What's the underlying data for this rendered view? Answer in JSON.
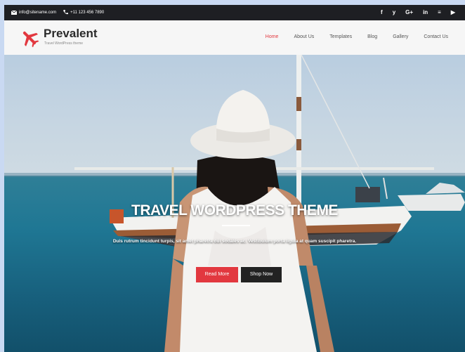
{
  "topbar": {
    "email": "info@sitename.com",
    "phone": "+11 123 456 7890",
    "social_icons": [
      "facebook-icon",
      "twitter-icon",
      "google-plus-icon",
      "linkedin-icon",
      "rss-icon",
      "youtube-icon"
    ],
    "social_glyphs": [
      "f",
      "y",
      "G+",
      "in",
      "≡",
      "▶"
    ]
  },
  "header": {
    "brand": "Prevalent",
    "tagline": "Travel WordPress theme",
    "nav": [
      "Home",
      "About Us",
      "Templates",
      "Blog",
      "Gallery",
      "Contact Us"
    ],
    "active_nav": "Home"
  },
  "hero": {
    "title": "TRAVEL WORDPRESS THEME",
    "subtitle": "Duis rutrum tincidunt turpis, sit amet pharetra dui sodales ac. Vestibulum porta ligula at quam suscipit pharetra.",
    "primary_button": "Read More",
    "secondary_button": "Shop Now"
  },
  "colors": {
    "accent": "#e2383f",
    "topbar": "#1e1f23",
    "dark_button": "#222222"
  }
}
